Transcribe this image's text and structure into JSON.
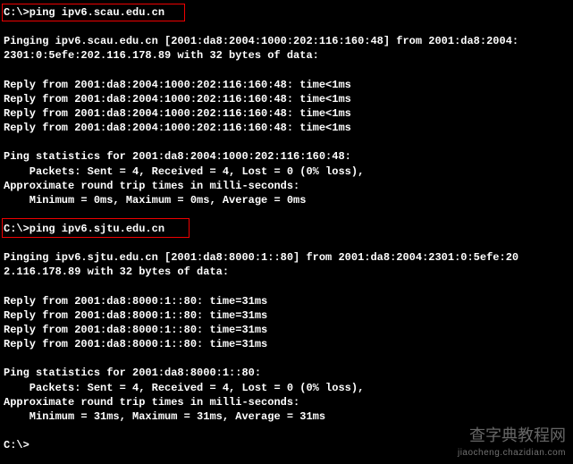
{
  "ping1": {
    "command": "C:\\>ping ipv6.scau.edu.cn",
    "header_l1": "Pinging ipv6.scau.edu.cn [2001:da8:2004:1000:202:116:160:48] from 2001:da8:2004:",
    "header_l2": "2301:0:5efe:202.116.178.89 with 32 bytes of data:",
    "replies": [
      "Reply from 2001:da8:2004:1000:202:116:160:48: time<1ms",
      "Reply from 2001:da8:2004:1000:202:116:160:48: time<1ms",
      "Reply from 2001:da8:2004:1000:202:116:160:48: time<1ms",
      "Reply from 2001:da8:2004:1000:202:116:160:48: time<1ms"
    ],
    "stats_header": "Ping statistics for 2001:da8:2004:1000:202:116:160:48:",
    "packets": "    Packets: Sent = 4, Received = 4, Lost = 0 (0% loss),",
    "approx": "Approximate round trip times in milli-seconds:",
    "times": "    Minimum = 0ms, Maximum = 0ms, Average = 0ms"
  },
  "ping2": {
    "command": "C:\\>ping ipv6.sjtu.edu.cn",
    "header_l1": "Pinging ipv6.sjtu.edu.cn [2001:da8:8000:1::80] from 2001:da8:2004:2301:0:5efe:20",
    "header_l2": "2.116.178.89 with 32 bytes of data:",
    "replies": [
      "Reply from 2001:da8:8000:1::80: time=31ms",
      "Reply from 2001:da8:8000:1::80: time=31ms",
      "Reply from 2001:da8:8000:1::80: time=31ms",
      "Reply from 2001:da8:8000:1::80: time=31ms"
    ],
    "stats_header": "Ping statistics for 2001:da8:8000:1::80:",
    "packets": "    Packets: Sent = 4, Received = 4, Lost = 0 (0% loss),",
    "approx": "Approximate round trip times in milli-seconds:",
    "times": "    Minimum = 31ms, Maximum = 31ms, Average = 31ms"
  },
  "prompt": "C:\\>",
  "watermark": {
    "main": "查字典教程网",
    "sub": "jiaocheng.chazidian.com"
  }
}
